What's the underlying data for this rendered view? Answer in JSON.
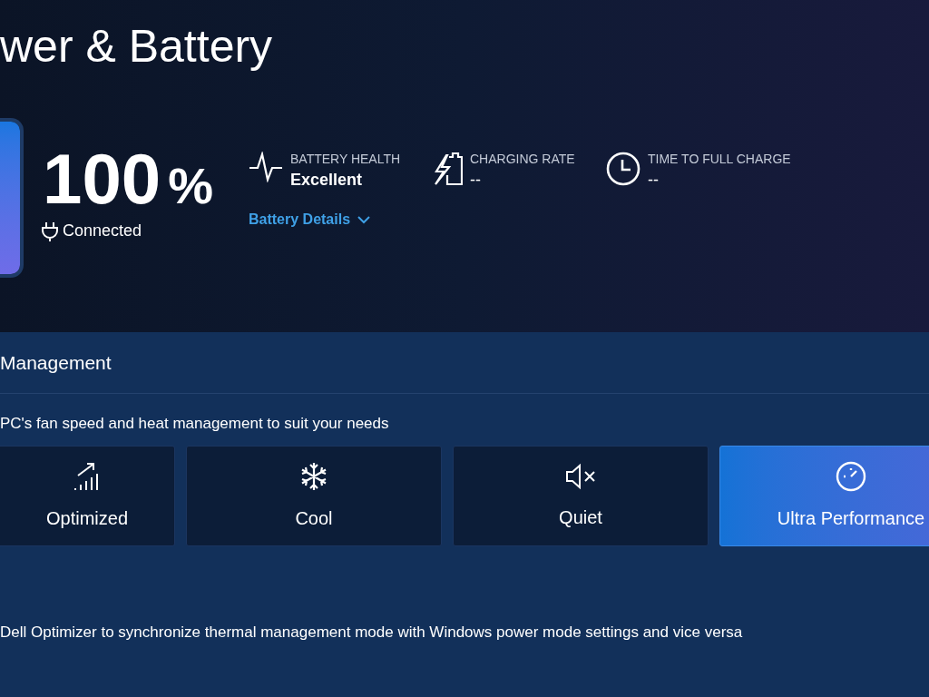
{
  "header": {
    "title": "wer & Battery"
  },
  "battery": {
    "level": 1,
    "percent": "100",
    "unit": "%",
    "status": "Connected"
  },
  "stats": [
    {
      "kind": "health",
      "label": "BATTERY HEALTH",
      "value": "Excellent",
      "link": "Battery Details"
    },
    {
      "kind": "charging",
      "label": "CHARGING RATE",
      "value": "--"
    },
    {
      "kind": "time",
      "label": "TIME TO FULL CHARGE",
      "value": "--"
    }
  ],
  "thermal": {
    "title": "Management",
    "description": "PC's fan speed and heat management to suit your needs",
    "modes": [
      {
        "kind": "optimized",
        "label": "Optimized",
        "selected": false
      },
      {
        "kind": "cool",
        "label": "Cool",
        "selected": false
      },
      {
        "kind": "quiet",
        "label": "Quiet",
        "selected": false
      },
      {
        "kind": "ultra",
        "label": "Ultra Performance",
        "selected": true
      }
    ],
    "footer": "Dell Optimizer to synchronize thermal management mode with Windows power mode settings and vice versa"
  }
}
